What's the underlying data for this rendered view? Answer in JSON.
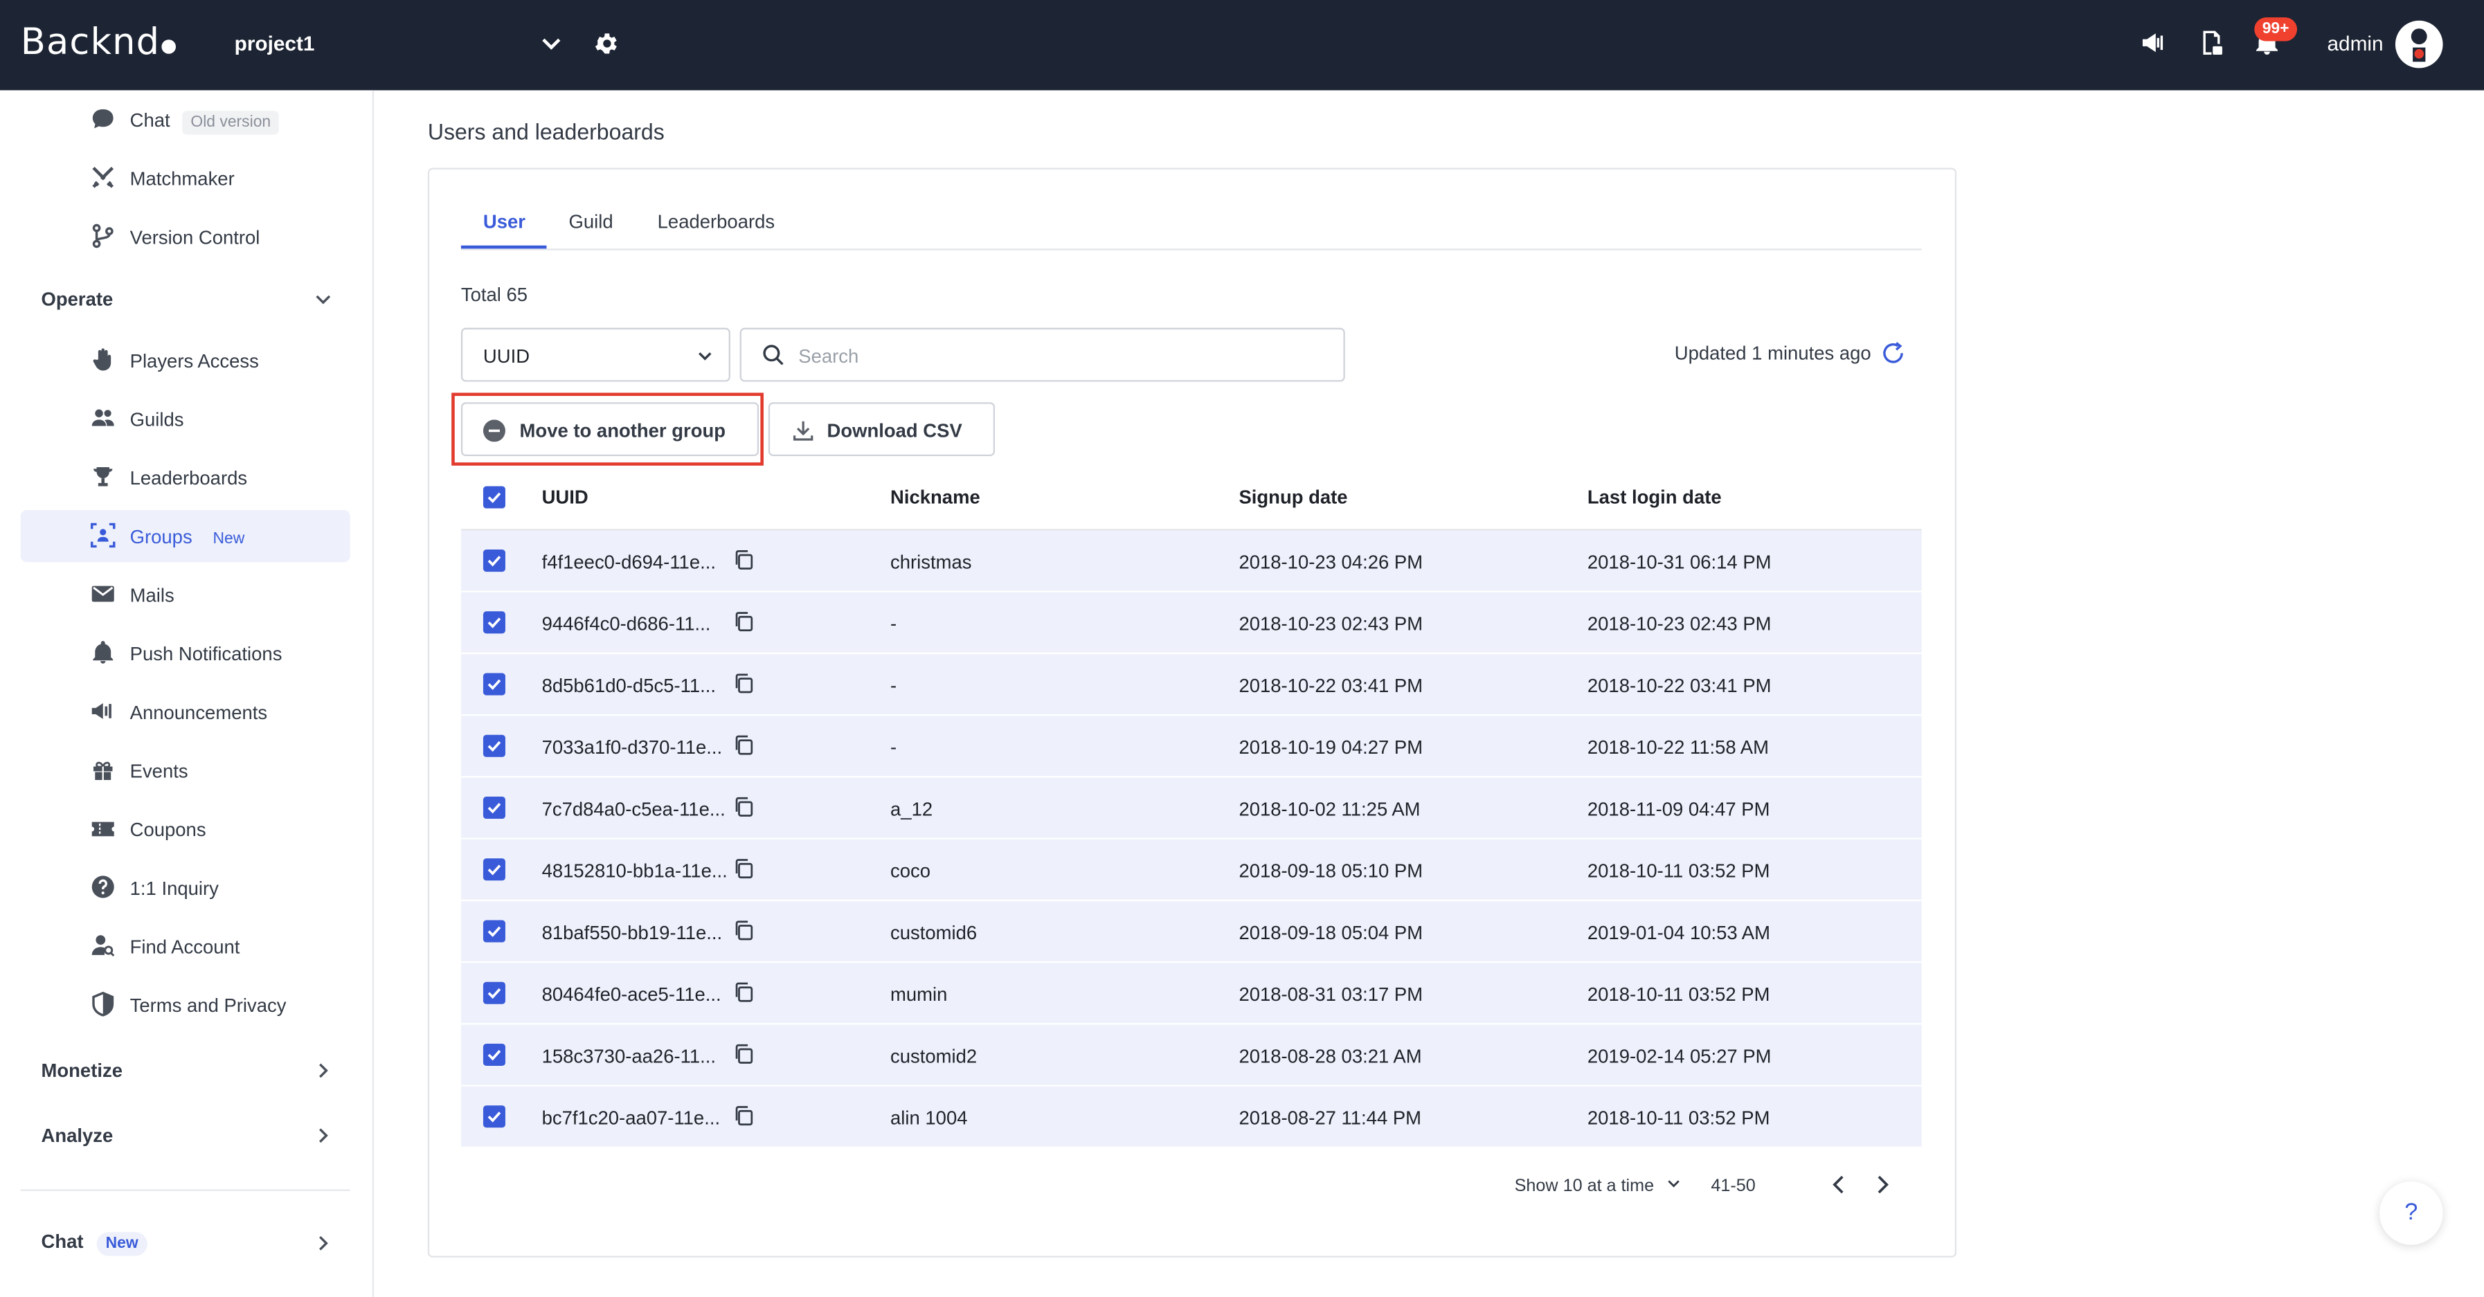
{
  "header": {
    "logo": "Backnd",
    "project": "project1",
    "notification_count": "99+",
    "user": "admin"
  },
  "sidebar": {
    "top_items": [
      {
        "label": "Chat",
        "tag": "Old version",
        "icon": "chat-bubble-icon"
      },
      {
        "label": "Matchmaker",
        "icon": "swords-icon"
      },
      {
        "label": "Version Control",
        "icon": "branch-icon"
      }
    ],
    "operate": {
      "label": "Operate",
      "items": [
        {
          "label": "Players Access",
          "icon": "hand-icon"
        },
        {
          "label": "Guilds",
          "icon": "people-icon"
        },
        {
          "label": "Leaderboards",
          "icon": "trophy-icon"
        },
        {
          "label": "Groups",
          "tag": "New",
          "icon": "group-icon",
          "active": true
        },
        {
          "label": "Mails",
          "icon": "mail-icon"
        },
        {
          "label": "Push Notifications",
          "icon": "bell-icon"
        },
        {
          "label": "Announcements",
          "icon": "megaphone-icon"
        },
        {
          "label": "Events",
          "icon": "gift-icon"
        },
        {
          "label": "Coupons",
          "icon": "ticket-icon"
        },
        {
          "label": "1:1 Inquiry",
          "icon": "question-icon"
        },
        {
          "label": "Find Account",
          "icon": "user-search-icon"
        },
        {
          "label": "Terms and Privacy",
          "icon": "shield-icon"
        }
      ]
    },
    "monetize": "Monetize",
    "analyze": "Analyze",
    "chat": {
      "label": "Chat",
      "tag": "New"
    }
  },
  "main": {
    "title": "Users and leaderboards",
    "tabs": [
      "User",
      "Guild",
      "Leaderboards"
    ],
    "total": "Total 65",
    "select_value": "UUID",
    "search_placeholder": "Search",
    "updated": "Updated 1 minutes ago",
    "move_button": "Move to another group",
    "download_button": "Download CSV",
    "columns": [
      "UUID",
      "Nickname",
      "Signup date",
      "Last login date"
    ],
    "rows": [
      {
        "uuid": "f4f1eec0-d694-11e...",
        "nickname": "christmas",
        "signup": "2018-10-23 04:26 PM",
        "login": "2018-10-31 06:14 PM"
      },
      {
        "uuid": "9446f4c0-d686-11...",
        "nickname": "-",
        "signup": "2018-10-23 02:43 PM",
        "login": "2018-10-23 02:43 PM"
      },
      {
        "uuid": "8d5b61d0-d5c5-11...",
        "nickname": "-",
        "signup": "2018-10-22 03:41 PM",
        "login": "2018-10-22 03:41 PM"
      },
      {
        "uuid": "7033a1f0-d370-11e...",
        "nickname": "-",
        "signup": "2018-10-19 04:27 PM",
        "login": "2018-10-22 11:58 AM"
      },
      {
        "uuid": "7c7d84a0-c5ea-11e...",
        "nickname": "a_12",
        "signup": "2018-10-02 11:25 AM",
        "login": "2018-11-09 04:47 PM"
      },
      {
        "uuid": "48152810-bb1a-11e...",
        "nickname": "coco",
        "signup": "2018-09-18 05:10 PM",
        "login": "2018-10-11 03:52 PM"
      },
      {
        "uuid": "81baf550-bb19-11e...",
        "nickname": "customid6",
        "signup": "2018-09-18 05:04 PM",
        "login": "2019-01-04 10:53 AM"
      },
      {
        "uuid": "80464fe0-ace5-11e...",
        "nickname": "mumin",
        "signup": "2018-08-31 03:17 PM",
        "login": "2018-10-11 03:52 PM"
      },
      {
        "uuid": "158c3730-aa26-11...",
        "nickname": "customid2",
        "signup": "2018-08-28 03:21 AM",
        "login": "2019-02-14 05:27 PM"
      },
      {
        "uuid": "bc7f1c20-aa07-11e...",
        "nickname": "alin 1004",
        "signup": "2018-08-27 11:44 PM",
        "login": "2018-10-11 03:52 PM"
      }
    ],
    "page_size": "Show 10 at a time",
    "range": "41-50",
    "help": "?"
  },
  "colors": {
    "accent": "#3a5bd9",
    "topbar": "#1d2433",
    "highlight": "#e23b2e",
    "badge": "#f0412f"
  }
}
